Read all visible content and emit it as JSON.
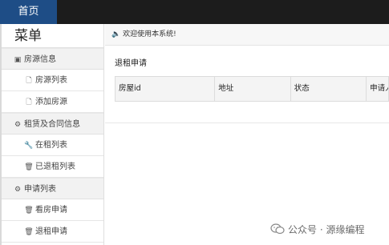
{
  "topbar": {
    "home_tab": "首页"
  },
  "sidebar": {
    "title": "菜单",
    "groups": [
      {
        "label": "房源信息",
        "icon": "house-icon",
        "items": [
          {
            "label": "房源列表",
            "icon": "document-icon"
          },
          {
            "label": "添加房源",
            "icon": "document-icon"
          }
        ]
      },
      {
        "label": "租赁及合同信息",
        "icon": "gear-icon",
        "items": [
          {
            "label": "在租列表",
            "icon": "wrench-icon"
          },
          {
            "label": "已退租列表",
            "icon": "trash-icon"
          }
        ]
      },
      {
        "label": "申请列表",
        "icon": "gear-icon",
        "items": [
          {
            "label": "看房申请",
            "icon": "trash-icon"
          },
          {
            "label": "退租申请",
            "icon": "trash-icon"
          }
        ]
      }
    ]
  },
  "notice": {
    "icon": "speaker-icon",
    "text": "欢迎使用本系统!"
  },
  "main": {
    "panel_title": "退租申请",
    "table": {
      "columns": [
        "房屋id",
        "地址",
        "状态",
        "申请人"
      ]
    }
  },
  "watermark": {
    "text": "公众号 · 源缘编程",
    "icon": "wechat-icon"
  }
}
